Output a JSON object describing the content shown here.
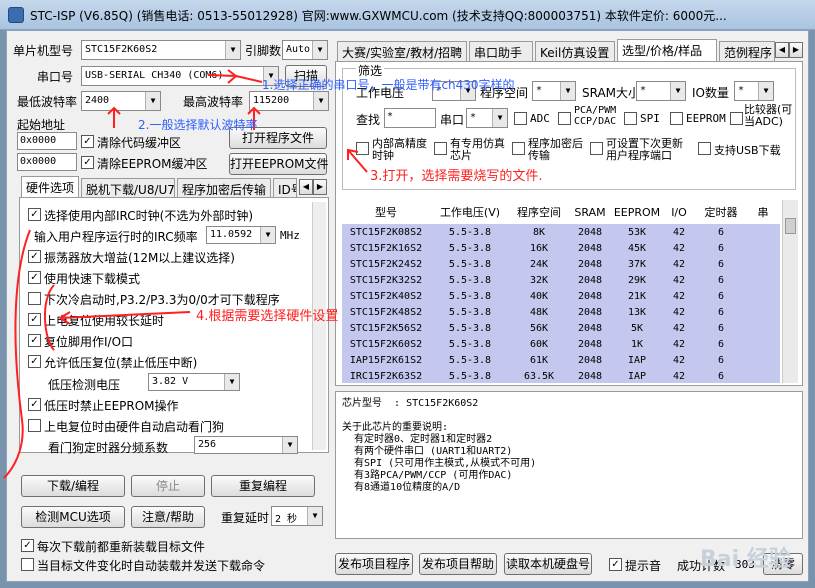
{
  "window": {
    "title": "STC-ISP (V6.85Q) (销售电话: 0513-55012928) 官网:www.GXWMCU.com  (技术支持QQ:800003751) 本软件定价: 6000元..."
  },
  "left": {
    "mcu_label": "单片机型号",
    "mcu_value": "STC15F2K60S2",
    "pins_label": "引脚数",
    "pins_value": "Auto",
    "port_label": "串口号",
    "port_value": "USB-SERIAL CH340 (COM6)",
    "scan_btn": "扫描",
    "min_baud_label": "最低波特率",
    "min_baud": "2400",
    "max_baud_label": "最高波特率",
    "max_baud": "115200",
    "start_addr_label": "起始地址",
    "addr1": "0x0000",
    "addr2": "0x0000",
    "clear_code": "清除代码缓冲区",
    "clear_eeprom": "清除EEPROM缓冲区",
    "open_prog_btn": "打开程序文件",
    "open_eeprom_btn": "打开EEPROM文件",
    "tabs": [
      "硬件选项",
      "脱机下载/U8/U7",
      "程序加密后传输",
      "ID号"
    ],
    "options": [
      {
        "label": "选择使用内部IRC时钟(不选为外部时钟)",
        "checked": true
      },
      {
        "label": "输入用户程序运行时的IRC频率",
        "value": "11.0592",
        "unit": "MHz"
      },
      {
        "label": "振荡器放大增益(12M以上建议选择)",
        "checked": true
      },
      {
        "label": "使用快速下载模式",
        "checked": true
      },
      {
        "label": "下次冷启动时,P3.2/P3.3为0/0才可下载程序",
        "checked": false
      },
      {
        "label": "上电复位使用较长延时",
        "checked": true
      },
      {
        "label": "复位脚用作I/O口",
        "checked": true
      },
      {
        "label": "允许低压复位(禁止低压中断)",
        "checked": true
      },
      {
        "label": "低压检测电压",
        "value": "3.82 V"
      },
      {
        "label": "低压时禁止EEPROM操作",
        "checked": true
      },
      {
        "label": "上电复位时由硬件自动启动看门狗",
        "checked": false
      },
      {
        "label": "看门狗定时器分频系数",
        "value": "256"
      }
    ],
    "download_btn": "下载/编程",
    "stop_btn": "停止",
    "reprogram_btn": "重复编程",
    "check_btn": "检测MCU选项",
    "help_btn": "注意/帮助",
    "delay_label": "重复延时",
    "delay_value": "2 秒",
    "reload_each": "每次下载前都重新装载目标文件",
    "auto_load": "当目标文件变化时自动装载并发送下载命令"
  },
  "right": {
    "tabs": [
      "大赛/实验室/教材/招聘",
      "串口助手",
      "Keil仿真设置",
      "选型/价格/样品",
      "范例程序"
    ],
    "filter_label": "筛选",
    "filters": {
      "voltage": "工作电压",
      "flash": "程序空间",
      "sram": "SRAM大小",
      "io": "IO数量",
      "star": "*",
      "search": "查找",
      "search_val": "*",
      "uart": "串口",
      "adc": "ADC",
      "pca": "PCA/PWM CCP/DAC",
      "spi": "SPI",
      "eeprom": "EEPROM",
      "comparator": "比较器(可当ADC)",
      "internal_rc": "内部高精度时钟",
      "dedicated_sim": "有专用仿真芯片",
      "encrypted": "程序加密后传输",
      "user_port": "可设置下次更新用户程序端口",
      "usb": "支持USB下载"
    },
    "table": {
      "headers": [
        "型号",
        "工作电压(V)",
        "程序空间",
        "SRAM",
        "EEPROM",
        "I/O",
        "定时器",
        "串"
      ],
      "rows": [
        [
          "STC15F2K08S2",
          "5.5-3.8",
          "8K",
          "2048",
          "53K",
          "42",
          "6",
          ""
        ],
        [
          "STC15F2K16S2",
          "5.5-3.8",
          "16K",
          "2048",
          "45K",
          "42",
          "6",
          ""
        ],
        [
          "STC15F2K24S2",
          "5.5-3.8",
          "24K",
          "2048",
          "37K",
          "42",
          "6",
          ""
        ],
        [
          "STC15F2K32S2",
          "5.5-3.8",
          "32K",
          "2048",
          "29K",
          "42",
          "6",
          ""
        ],
        [
          "STC15F2K40S2",
          "5.5-3.8",
          "40K",
          "2048",
          "21K",
          "42",
          "6",
          ""
        ],
        [
          "STC15F2K48S2",
          "5.5-3.8",
          "48K",
          "2048",
          "13K",
          "42",
          "6",
          ""
        ],
        [
          "STC15F2K56S2",
          "5.5-3.8",
          "56K",
          "2048",
          "5K",
          "42",
          "6",
          ""
        ],
        [
          "STC15F2K60S2",
          "5.5-3.8",
          "60K",
          "2048",
          "1K",
          "42",
          "6",
          ""
        ],
        [
          "IAP15F2K61S2",
          "5.5-3.8",
          "61K",
          "2048",
          "IAP",
          "42",
          "6",
          ""
        ],
        [
          "IRC15F2K63S2",
          "5.5-3.8",
          "63.5K",
          "2048",
          "IAP",
          "42",
          "6",
          ""
        ]
      ]
    },
    "info": [
      "芯片型号  : STC15F2K60S2",
      "",
      "关于此芯片的重要说明:",
      "  有定时器0、定时器1和定时器2",
      "  有两个硬件串口 (UART1和UART2)",
      "  有SPI (只可用作主模式,从模式不可用)",
      "  有3路PCA/PWM/CCP (可用作DAC)",
      "  有8通道10位精度的A/D"
    ],
    "publish_btn": "发布项目程序",
    "publish_help_btn": "发布项目帮助",
    "read_disk_btn": "读取本机硬盘号",
    "beep_label": "提示音",
    "success_label": "成功计数",
    "count": "303",
    "clear_btn": "清零"
  },
  "annotations": {
    "a1": "1.选择正确的串口号，一般是带有ch430字样的",
    "a2": "2.一般选择默认波特率",
    "a3": "3.打开，选择需要烧写的文件.",
    "a4": "4.根据需要选择硬件设置"
  },
  "watermark": "Bai 经验"
}
